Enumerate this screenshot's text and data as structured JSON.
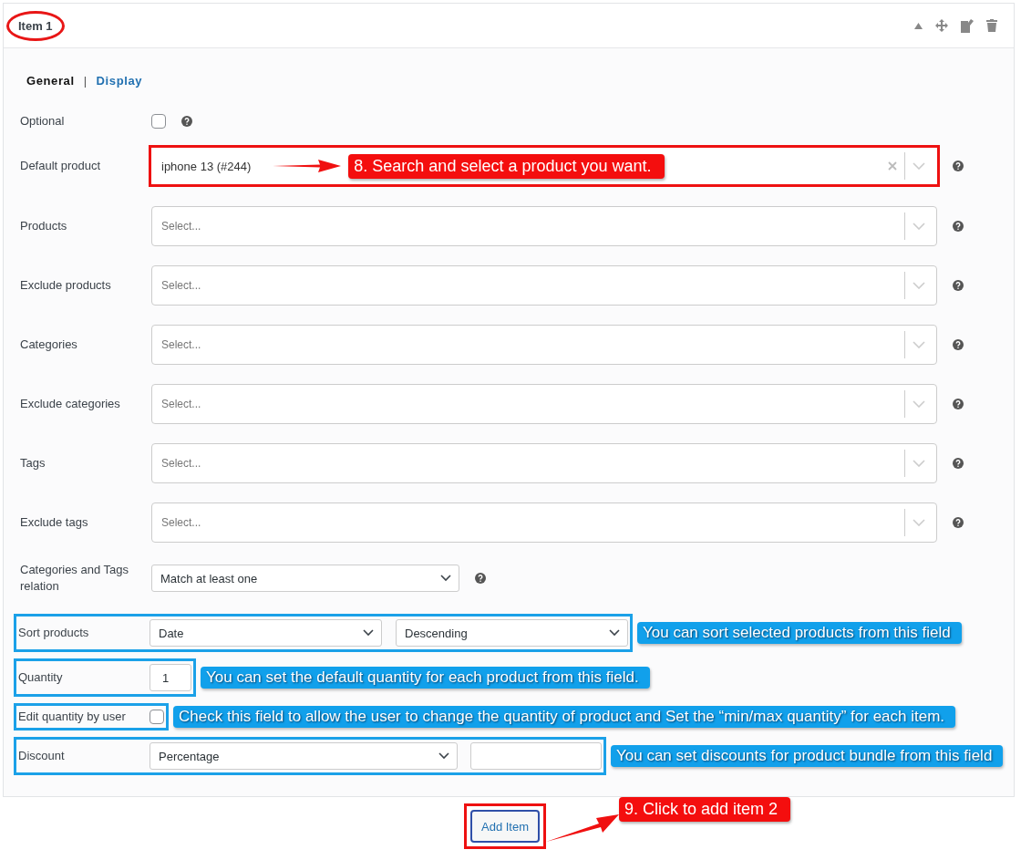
{
  "header": {
    "title": "Item 1",
    "circled": true
  },
  "tabs": [
    {
      "label": "General",
      "selected": true
    },
    {
      "label": "Display",
      "selected": false
    }
  ],
  "tab_separator": "|",
  "fields": [
    {
      "kind": "checkbox",
      "label": "Optional",
      "checked": false,
      "help": true,
      "outlined": false
    },
    {
      "kind": "search_select",
      "label": "Default product",
      "value": "iphone 13 (#244)",
      "clearable": true,
      "help": true,
      "outlined": true,
      "callout": {
        "kind": "red",
        "text": "8. Search and select a product you want."
      }
    },
    {
      "kind": "search_select",
      "label": "Products",
      "placeholder": "Select...",
      "clearable": false,
      "help": true,
      "outlined": false
    },
    {
      "kind": "search_select",
      "label": "Exclude products",
      "placeholder": "Select...",
      "clearable": false,
      "help": true,
      "outlined": false
    },
    {
      "kind": "search_select",
      "label": "Categories",
      "placeholder": "Select...",
      "clearable": false,
      "help": true,
      "outlined": false
    },
    {
      "kind": "search_select",
      "label": "Exclude categories",
      "placeholder": "Select...",
      "clearable": false,
      "help": true,
      "outlined": false
    },
    {
      "kind": "search_select",
      "label": "Tags",
      "placeholder": "Select...",
      "clearable": false,
      "help": true,
      "outlined": false
    },
    {
      "kind": "search_select",
      "label": "Exclude tags",
      "placeholder": "Select...",
      "clearable": false,
      "help": true,
      "outlined": false
    },
    {
      "kind": "select",
      "label": "Categories and Tags relation",
      "value": "Match at least one",
      "help": true,
      "outlined": false
    },
    {
      "kind": "select_pair",
      "label": "Sort products",
      "values": [
        "Date",
        "Descending"
      ],
      "help": false,
      "outlined": true,
      "callout": {
        "kind": "blue",
        "text": "You can sort selected products from this field"
      }
    },
    {
      "kind": "number",
      "label": "Quantity",
      "value": "1",
      "help": false,
      "outlined": true,
      "callout": {
        "kind": "blue",
        "text": "You can set the default quantity for each product from this field."
      }
    },
    {
      "kind": "checkbox",
      "label": "Edit quantity by user",
      "checked": false,
      "help": false,
      "outlined": true,
      "callout": {
        "kind": "blue",
        "text": "Check this field to allow the user to change the quantity of product and Set the “min/max quantity” for each item."
      }
    },
    {
      "kind": "select_input",
      "label": "Discount",
      "value": "Percentage",
      "help": false,
      "outlined": true,
      "callout": {
        "kind": "blue",
        "text": "You can set discounts for product bundle from this field"
      }
    }
  ],
  "add_button": {
    "label": "Add Item",
    "outlined": true,
    "callout": {
      "kind": "red",
      "text": "9. Click to add item 2"
    }
  }
}
